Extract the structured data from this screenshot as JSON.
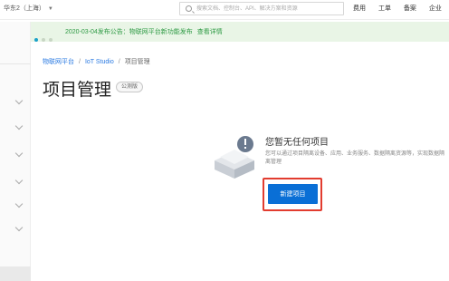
{
  "topbar": {
    "region": "华东2（上海）",
    "search_placeholder": "搜索文档、控制台、API、解决方案和资源",
    "links": [
      "费用",
      "工单",
      "备案",
      "企业"
    ]
  },
  "notice": {
    "text": "2020-03-04发布公告：物联网平台新功能发布",
    "link": "查看详情"
  },
  "breadcrumb": {
    "items": [
      "物联网平台",
      "IoT Studio",
      "项目管理"
    ],
    "separator": "/"
  },
  "page": {
    "title": "项目管理",
    "badge": "公测版"
  },
  "empty_state": {
    "title": "您暂无任何项目",
    "description": "您可以通过项目隔离设备、应用、业务服务、数据隔离资源等，实现数据隔离管理",
    "button_label": "新建项目",
    "icon": "empty-box-icon"
  },
  "colors": {
    "primary": "#0a6fd6",
    "notice_bg": "#e9f5e6",
    "notice_text": "#2e9a44",
    "highlight": "#e23c2f",
    "link": "#2a7ae2"
  }
}
